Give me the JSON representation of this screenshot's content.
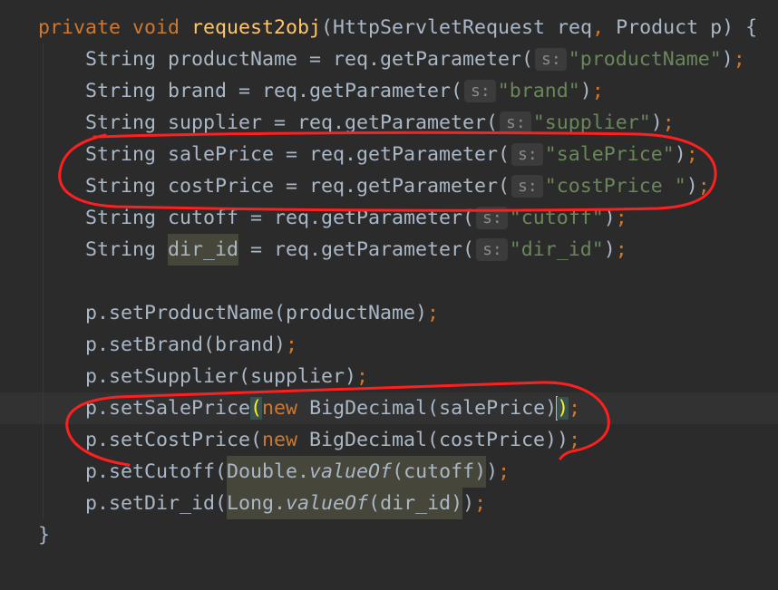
{
  "colors": {
    "background": "#2b2b2b",
    "text": "#a9b7c6",
    "keyword": "#cc7832",
    "punctuation": "#cc7832",
    "method_declaration": "#ffc66d",
    "string": "#6a8759",
    "current_line": "#323232",
    "hint_background": "#3b3b3b",
    "hint_text": "#8a8a8a",
    "warning_background": "#47463a",
    "usage_background": "#47463a",
    "brace_match_background": "#3b514d",
    "brace_match_text": "#ffef28",
    "caret": "#bbbbbb",
    "annotation": "#ff1f1f",
    "indent_guide": "#393939"
  },
  "editor": {
    "lines": [
      {
        "indent": "",
        "tokens": [
          {
            "type": "keyword",
            "text": "private "
          },
          {
            "type": "keyword",
            "text": "void "
          },
          {
            "type": "method",
            "text": "request2obj"
          },
          {
            "type": "plain",
            "text": "(HttpServletRequest req"
          },
          {
            "type": "punct",
            "text": ","
          },
          {
            "type": "plain",
            "text": " Product p) {"
          }
        ]
      },
      {
        "indent": "    ",
        "tokens": [
          {
            "type": "plain",
            "text": "String productName = req.getParameter("
          },
          {
            "type": "hint",
            "text": "s:"
          },
          {
            "type": "string",
            "text": "\"productName\""
          },
          {
            "type": "plain",
            "text": ")"
          },
          {
            "type": "punct",
            "text": ";"
          }
        ]
      },
      {
        "indent": "    ",
        "tokens": [
          {
            "type": "plain",
            "text": "String brand = req.getParameter("
          },
          {
            "type": "hint",
            "text": "s:"
          },
          {
            "type": "string",
            "text": "\"brand\""
          },
          {
            "type": "plain",
            "text": ")"
          },
          {
            "type": "punct",
            "text": ";"
          }
        ]
      },
      {
        "indent": "    ",
        "tokens": [
          {
            "type": "plain",
            "text": "String supplier = req.getParameter("
          },
          {
            "type": "hint",
            "text": "s:"
          },
          {
            "type": "string",
            "text": "\"supplier\""
          },
          {
            "type": "plain",
            "text": ")"
          },
          {
            "type": "punct",
            "text": ";"
          }
        ]
      },
      {
        "indent": "    ",
        "tokens": [
          {
            "type": "plain",
            "text": "String salePrice = req.getParameter("
          },
          {
            "type": "hint",
            "text": "s:"
          },
          {
            "type": "string",
            "text": "\"salePrice\""
          },
          {
            "type": "plain",
            "text": ")"
          },
          {
            "type": "punct",
            "text": ";"
          }
        ]
      },
      {
        "indent": "    ",
        "tokens": [
          {
            "type": "plain",
            "text": "String costPrice = req.getParameter("
          },
          {
            "type": "hint",
            "text": "s:"
          },
          {
            "type": "string",
            "text": "\"costPrice \""
          },
          {
            "type": "plain",
            "text": ")"
          },
          {
            "type": "punct",
            "text": ";"
          }
        ]
      },
      {
        "indent": "    ",
        "tokens": [
          {
            "type": "plain",
            "text": "String cutoff = req.getParameter("
          },
          {
            "type": "hint",
            "text": "s:"
          },
          {
            "type": "string",
            "text": "\"cutoff\""
          },
          {
            "type": "plain",
            "text": ")"
          },
          {
            "type": "punct",
            "text": ";"
          }
        ]
      },
      {
        "indent": "    ",
        "tokens": [
          {
            "type": "plain",
            "text": "String "
          },
          {
            "type": "plain",
            "text": "dir_id",
            "hl": "usage"
          },
          {
            "type": "plain",
            "text": " = req.getParameter("
          },
          {
            "type": "hint",
            "text": "s:"
          },
          {
            "type": "string",
            "text": "\"dir_id\""
          },
          {
            "type": "plain",
            "text": ")"
          },
          {
            "type": "punct",
            "text": ";"
          }
        ]
      },
      {
        "indent": "",
        "tokens": []
      },
      {
        "indent": "    ",
        "tokens": [
          {
            "type": "plain",
            "text": "p.setProductName(productName)"
          },
          {
            "type": "punct",
            "text": ";"
          }
        ]
      },
      {
        "indent": "    ",
        "tokens": [
          {
            "type": "plain",
            "text": "p.setBrand(brand)"
          },
          {
            "type": "punct",
            "text": ";"
          }
        ]
      },
      {
        "indent": "    ",
        "tokens": [
          {
            "type": "plain",
            "text": "p.setSupplier(supplier)"
          },
          {
            "type": "punct",
            "text": ";"
          }
        ]
      },
      {
        "indent": "    ",
        "current": true,
        "tokens": [
          {
            "type": "plain",
            "text": "p.setSalePrice"
          },
          {
            "type": "plain",
            "text": "(",
            "hl": "brace-match"
          },
          {
            "type": "keyword",
            "text": "new"
          },
          {
            "type": "plain",
            "text": " BigDecimal(salePrice)"
          },
          {
            "type": "caret"
          },
          {
            "type": "plain",
            "text": ")",
            "hl": "brace-match"
          },
          {
            "type": "punct",
            "text": ";"
          }
        ]
      },
      {
        "indent": "    ",
        "tokens": [
          {
            "type": "plain",
            "text": "p.setCostPrice("
          },
          {
            "type": "keyword",
            "text": "new"
          },
          {
            "type": "plain",
            "text": " BigDecimal(costPrice))"
          },
          {
            "type": "punct",
            "text": ";"
          }
        ]
      },
      {
        "indent": "    ",
        "tokens": [
          {
            "type": "plain",
            "text": "p.setCutoff("
          },
          {
            "type": "plain",
            "text": "Double.",
            "hl": "warning"
          },
          {
            "type": "static",
            "text": "valueOf",
            "hl": "warning"
          },
          {
            "type": "plain",
            "text": "(cutoff)",
            "hl": "warning"
          },
          {
            "type": "plain",
            "text": ")"
          },
          {
            "type": "punct",
            "text": ";"
          }
        ]
      },
      {
        "indent": "    ",
        "tokens": [
          {
            "type": "plain",
            "text": "p.setDir_id("
          },
          {
            "type": "plain",
            "text": "Long.",
            "hl": "warning"
          },
          {
            "type": "static",
            "text": "valueOf",
            "hl": "warning"
          },
          {
            "type": "plain",
            "text": "(dir_id)",
            "hl": "warning"
          },
          {
            "type": "plain",
            "text": ")"
          },
          {
            "type": "punct",
            "text": ";"
          }
        ]
      },
      {
        "indent": "",
        "tokens": [
          {
            "type": "plain",
            "text": "}"
          }
        ]
      }
    ]
  }
}
